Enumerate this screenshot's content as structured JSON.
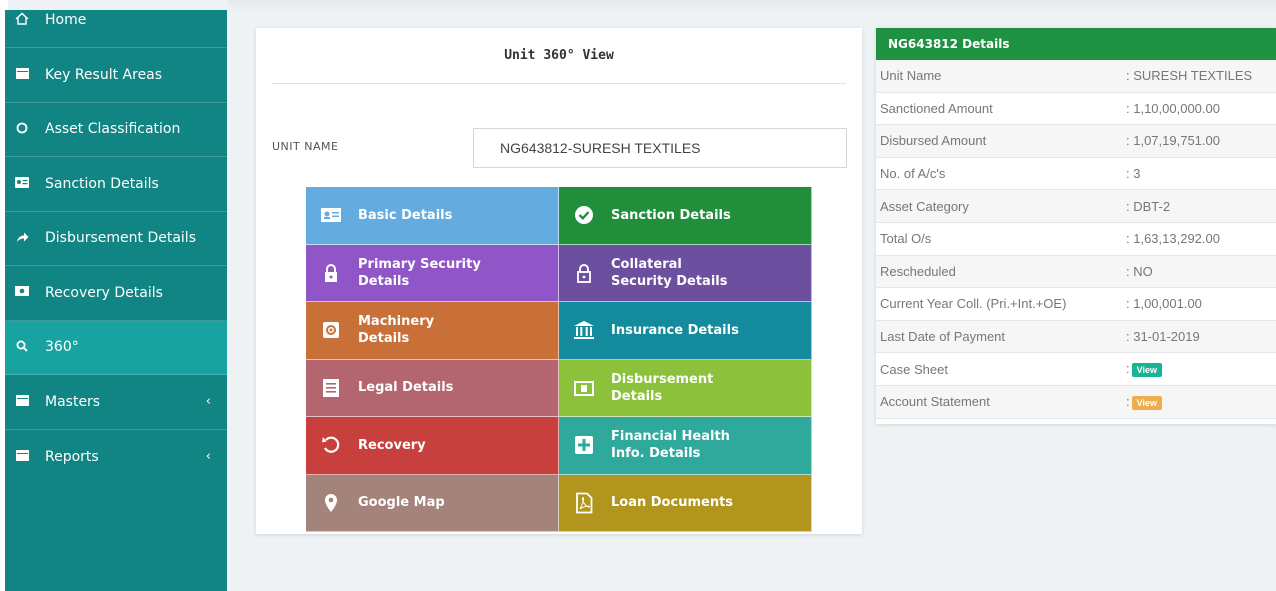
{
  "sidebar": {
    "items": [
      {
        "label": "Home",
        "icon": "home-icon"
      },
      {
        "label": "Key Result Areas",
        "icon": "list-icon"
      },
      {
        "label": "Asset Classification",
        "icon": "circle-icon"
      },
      {
        "label": "Sanction Details",
        "icon": "id-card-icon"
      },
      {
        "label": "Disbursement Details",
        "icon": "share-arrow-icon"
      },
      {
        "label": "Recovery Details",
        "icon": "money-icon"
      },
      {
        "label": "360°",
        "icon": "search-icon"
      },
      {
        "label": "Masters",
        "icon": "table-icon"
      },
      {
        "label": "Reports",
        "icon": "table-icon"
      }
    ]
  },
  "card": {
    "title": "Unit 360° View",
    "unit_label": "UNIT NAME",
    "unit_value": "NG643812-SURESH TEXTILES"
  },
  "tiles": [
    {
      "line1": "Basic Details",
      "line2": "",
      "color": "#64acdf",
      "icon": "id-card-icon"
    },
    {
      "line1": "Sanction Details",
      "line2": "",
      "color": "#218e3b",
      "icon": "check-circle-icon"
    },
    {
      "line1": "Primary Security",
      "line2": "Details",
      "color": "#9056c8",
      "icon": "lock-icon"
    },
    {
      "line1": "Collateral",
      "line2": "Security Details",
      "color": "#6d4f9f",
      "icon": "lock-outline-icon"
    },
    {
      "line1": "Machinery",
      "line2": "Details",
      "color": "#c97038",
      "icon": "gear-icon"
    },
    {
      "line1": "Insurance Details",
      "line2": "",
      "color": "#148b9c",
      "icon": "bank-icon"
    },
    {
      "line1": "Legal Details",
      "line2": "",
      "color": "#b36670",
      "icon": "document-icon"
    },
    {
      "line1": "Disbursement",
      "line2": "Details",
      "color": "#8cc13c",
      "icon": "money-icon"
    },
    {
      "line1": "Recovery",
      "line2": "",
      "color": "#c8403d",
      "icon": "undo-icon"
    },
    {
      "line1": "Financial Health",
      "line2": "Info. Details",
      "color": "#2ea99b",
      "icon": "plus-square-icon"
    },
    {
      "line1": "Google Map",
      "line2": "",
      "color": "#a3837a",
      "icon": "map-pin-icon"
    },
    {
      "line1": "Loan Documents",
      "line2": "",
      "color": "#b1951d",
      "icon": "pdf-icon"
    }
  ],
  "details": {
    "title": "NG643812 Details",
    "rows": [
      {
        "label": "Unit Name",
        "value": ": SURESH TEXTILES"
      },
      {
        "label": "Sanctioned Amount",
        "value": ": 1,10,00,000.00"
      },
      {
        "label": "Disbursed Amount",
        "value": ": 1,07,19,751.00"
      },
      {
        "label": "No. of A/c's",
        "value": ": 3"
      },
      {
        "label": "Asset Category",
        "value": ": DBT-2"
      },
      {
        "label": "Total O/s",
        "value": ": 1,63,13,292.00"
      },
      {
        "label": "Rescheduled",
        "value": ": NO"
      },
      {
        "label": "Current Year Coll. (Pri.+Int.+OE)",
        "value": ": 1,00,001.00"
      },
      {
        "label": "Last Date of Payment",
        "value": ": 31-01-2019"
      }
    ],
    "action_rows": [
      {
        "label": "Case Sheet",
        "prefix": ":",
        "button": "View",
        "color": "#1ab394"
      },
      {
        "label": "Account Statement",
        "prefix": ":",
        "button": "View",
        "color": "#f0ad4e"
      }
    ]
  }
}
